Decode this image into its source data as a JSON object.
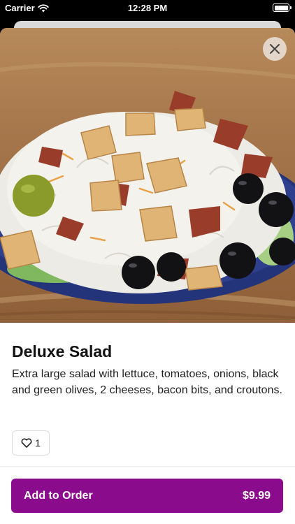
{
  "status_bar": {
    "carrier": "Carrier",
    "time": "12:28 PM"
  },
  "item": {
    "name": "Deluxe Salad",
    "description": "Extra large salad with lettuce, tomatoes, onions, black and green olives, 2 cheeses, bacon bits, and croutons.",
    "like_count": "1"
  },
  "order": {
    "label": "Add to Order",
    "price": "$9.99"
  },
  "colors": {
    "accent": "#8a0c8c"
  },
  "icons": {
    "close": "close-icon",
    "like": "heart-icon",
    "wifi": "wifi-icon",
    "battery": "battery-icon"
  }
}
